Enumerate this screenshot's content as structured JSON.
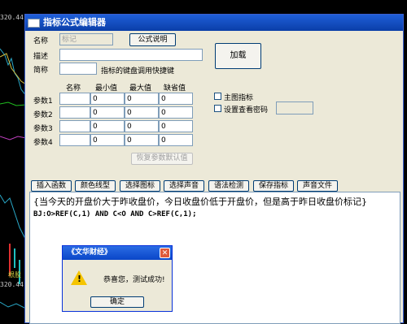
{
  "background": {
    "price_top": "320.44",
    "price_bottom": "320.44",
    "chart_label": "根股"
  },
  "window": {
    "title": "指标公式编辑器",
    "name_label": "名称",
    "name_value": "标记",
    "formula_help_button": "公式说明",
    "desc_label": "描述",
    "desc_value": "",
    "abbr_label": "简称",
    "abbr_value": "",
    "hotkey_hint": "指标的键盘调用快捷键",
    "load_button": "加载",
    "param_headers": [
      "名称",
      "最小值",
      "最大值",
      "缺省值"
    ],
    "params": [
      {
        "label": "参数1",
        "name": "",
        "min": "0",
        "max": "0",
        "default": "0"
      },
      {
        "label": "参数2",
        "name": "",
        "min": "0",
        "max": "0",
        "default": "0"
      },
      {
        "label": "参数3",
        "name": "",
        "min": "0",
        "max": "0",
        "default": "0"
      },
      {
        "label": "参数4",
        "name": "",
        "min": "0",
        "max": "0",
        "default": "0"
      }
    ],
    "main_chart_indicator_label": "主图指标",
    "set_password_label": "设置查看密码",
    "password_value": "",
    "restore_defaults_button": "恢复参数默认值",
    "toolbar": [
      "插入函数",
      "颜色线型",
      "选择图标",
      "选择声音",
      "语法检测",
      "保存指标",
      "声音文件"
    ],
    "editor_line1": "{当今天的开盘价大于昨收盘价，今日收盘价低于开盘价，但是高于昨日收盘价标记}",
    "editor_line2": "BJ:O>REF(C,1) AND C<O AND C>REF(C,1);"
  },
  "dialog": {
    "title": "《文华财经》",
    "close_icon": "close-icon",
    "message": "恭喜您，测试成功!",
    "ok_button": "确定",
    "icon": "warning-icon"
  },
  "colors": {
    "titlebar": "#0a3ea8",
    "window_bg": "#ece9d8",
    "dialog_close": "#e05a3a",
    "warning": "#f5c400"
  }
}
